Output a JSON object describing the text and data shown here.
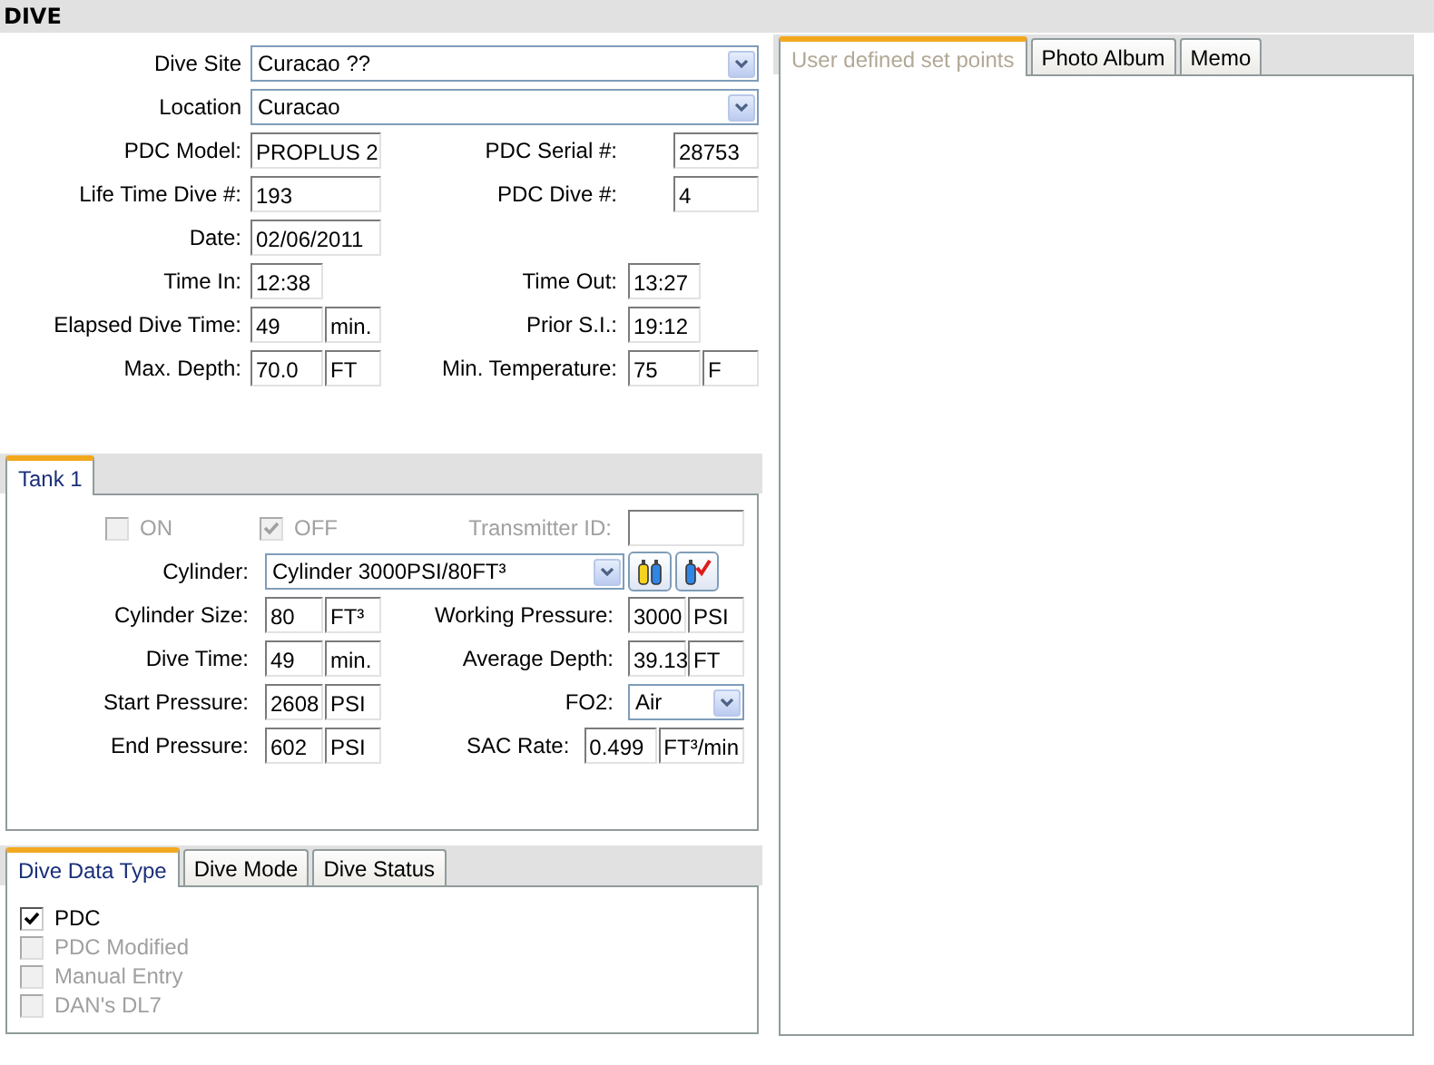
{
  "title": "DIVE",
  "dive_rows": [
    {
      "left": {
        "label": "Dive Site",
        "kind": "dropdown",
        "value": "Curacao ??"
      }
    },
    {
      "left": {
        "label": "Location",
        "kind": "dropdown",
        "value": "Curacao"
      }
    },
    {
      "left": {
        "label": "PDC Model:",
        "kind": "text",
        "value": "PROPLUS 2"
      },
      "right": {
        "label": "PDC Serial #:",
        "kind": "number",
        "value": "28753"
      }
    },
    {
      "left": {
        "label": "Life Time Dive #:",
        "kind": "text",
        "value": "193"
      },
      "right": {
        "label": "PDC Dive #:",
        "kind": "number",
        "value": "4"
      }
    },
    {
      "left": {
        "label": "Date:",
        "kind": "text",
        "value": "02/06/2011"
      }
    },
    {
      "left": {
        "label": "Time In:",
        "kind": "short",
        "value": "12:38"
      },
      "right": {
        "label": "Time Out:",
        "kind": "short",
        "value": "13:27"
      }
    },
    {
      "left": {
        "label": "Elapsed Dive Time:",
        "kind": "short",
        "value": "49",
        "unit": "min."
      },
      "right": {
        "label": "Prior S.I.:",
        "kind": "short",
        "value": "19:12"
      }
    },
    {
      "left": {
        "label": "Max. Depth:",
        "kind": "short",
        "value": "70.0",
        "unit": "FT"
      },
      "right": {
        "label": "Min. Temperature:",
        "kind": "short",
        "value": "75",
        "unit": "F"
      }
    }
  ],
  "tank": {
    "tabs": [
      {
        "label": "Tank 1",
        "selected": true,
        "disabled": false
      }
    ],
    "switches": [
      {
        "label": "ON",
        "checked": false,
        "disabled": true
      },
      {
        "label": "OFF",
        "checked": true,
        "disabled": true
      }
    ],
    "transmitter": {
      "label": "Transmitter ID:",
      "disabled": true
    },
    "cylinder": {
      "label": "Cylinder:",
      "value": "Cylinder 3000PSI/80FT³"
    },
    "rows": [
      {
        "left": {
          "label": "Cylinder Size:",
          "kind": "short",
          "value": "80",
          "unit": "FT³"
        },
        "right": {
          "label": "Working Pressure:",
          "kind": "short",
          "value": "3000",
          "unit": "PSI"
        }
      },
      {
        "left": {
          "label": "Dive Time:",
          "kind": "short",
          "value": "49",
          "unit": "min."
        },
        "right": {
          "label": "Average Depth:",
          "kind": "short",
          "value": "39.13",
          "unit": "FT"
        }
      },
      {
        "left": {
          "label": "Start Pressure:",
          "kind": "short",
          "value": "2608",
          "unit": "PSI"
        },
        "right": {
          "label": "FO2:",
          "kind": "dropdown",
          "value": "Air"
        }
      },
      {
        "left": {
          "label": "End Pressure:",
          "kind": "short",
          "value": "602",
          "unit": "PSI"
        },
        "right": {
          "label": "SAC Rate:",
          "kind": "wide",
          "value": "0.499",
          "unit": "FT³/min"
        }
      }
    ]
  },
  "data_tabs": [
    {
      "label": "Dive Data Type",
      "selected": true,
      "disabled": false
    },
    {
      "label": "Dive Mode",
      "selected": false,
      "disabled": false
    },
    {
      "label": "Dive Status",
      "selected": false,
      "disabled": false
    }
  ],
  "data_types": [
    {
      "label": "PDC",
      "checked": true,
      "disabled": false
    },
    {
      "label": "PDC Modified",
      "checked": false,
      "disabled": true
    },
    {
      "label": "Manual Entry",
      "checked": false,
      "disabled": true
    },
    {
      "label": "DAN's DL7",
      "checked": false,
      "disabled": true
    }
  ],
  "side_tabs": [
    {
      "label": "User defined set points",
      "selected": true,
      "disabled": true
    },
    {
      "label": "Photo Album",
      "selected": false,
      "disabled": false
    },
    {
      "label": "Memo",
      "selected": false,
      "disabled": false
    }
  ]
}
